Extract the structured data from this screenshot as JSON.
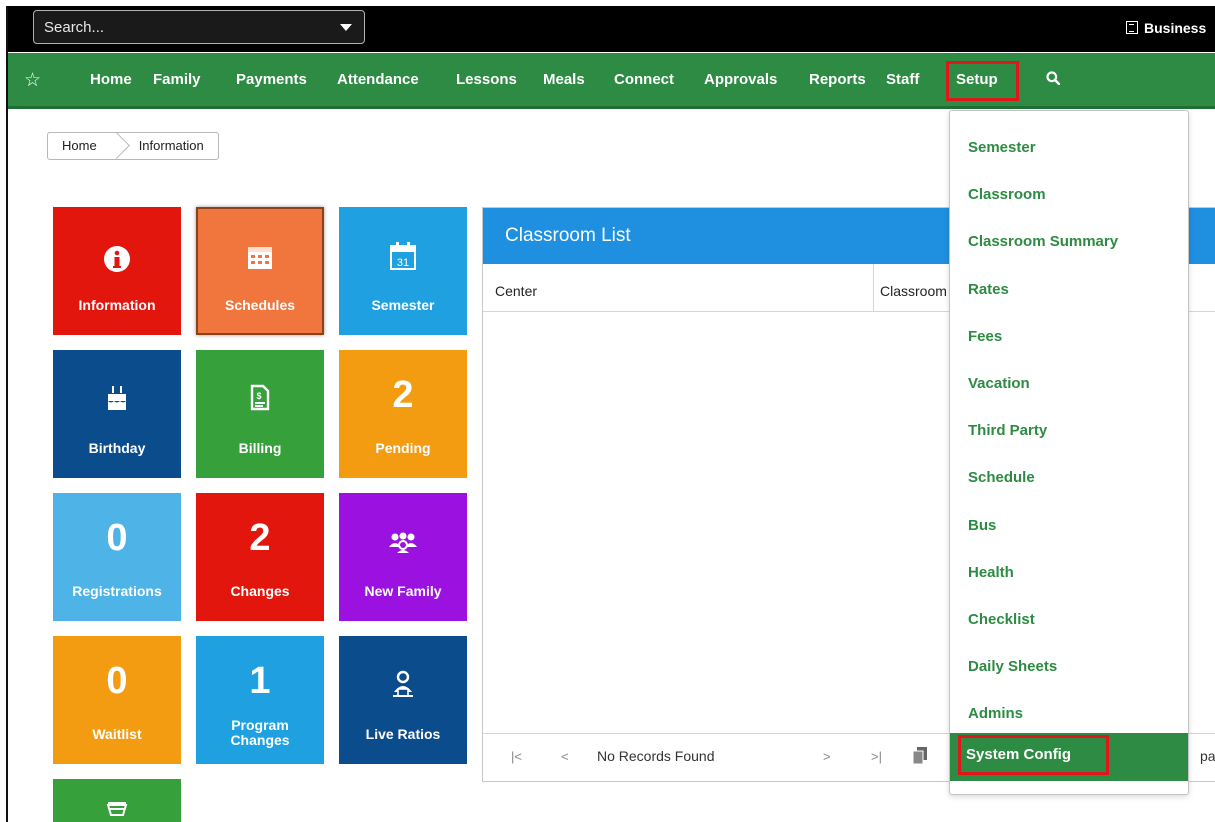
{
  "topbar": {
    "search_placeholder": "Search...",
    "business_label": "Business"
  },
  "nav": {
    "items": [
      "Home",
      "Family",
      "Payments",
      "Attendance",
      "Lessons",
      "Meals",
      "Connect",
      "Approvals",
      "Reports",
      "Staff",
      "Setup"
    ]
  },
  "breadcrumb": [
    "Home",
    "Information"
  ],
  "tiles": [
    {
      "label": "Information",
      "color": "#e2160d",
      "icon": "info-icon"
    },
    {
      "label": "Schedules",
      "color": "#f0763e",
      "icon": "calendar-grid-icon"
    },
    {
      "label": "Semester",
      "color": "#1fa0e1",
      "icon": "calendar-31-icon"
    },
    {
      "label": "Birthday",
      "color": "#0b4c8c",
      "icon": "birthday-cake-icon"
    },
    {
      "label": "Billing",
      "color": "#36a03b",
      "icon": "invoice-icon"
    },
    {
      "label": "Pending",
      "color": "#f39c12",
      "number": "2"
    },
    {
      "label": "Registrations",
      "color": "#4eb3e6",
      "number": "0"
    },
    {
      "label": "Changes",
      "color": "#e2160d",
      "number": "2"
    },
    {
      "label": "New Family",
      "color": "#9b12e0",
      "icon": "family-group-icon"
    },
    {
      "label": "Waitlist",
      "color": "#f39c12",
      "number": "0"
    },
    {
      "label": "Program Changes",
      "color": "#1fa0e1",
      "number": "1"
    },
    {
      "label": "Live Ratios",
      "color": "#0b4c8c",
      "icon": "teacher-ratio-icon"
    },
    {
      "label": "",
      "color": "#36a03b",
      "icon": "bowl-icon"
    }
  ],
  "classroom_panel": {
    "title": "Classroom List",
    "columns": [
      "Center",
      "Classroom"
    ],
    "pager": {
      "first": "|<",
      "prev": "<",
      "next": ">",
      "last": ">|",
      "status": "No Records Found",
      "page_text": "page"
    }
  },
  "setup_menu": {
    "items": [
      "Semester",
      "Classroom",
      "Classroom Summary",
      "Rates",
      "Fees",
      "Vacation",
      "Third Party",
      "Schedule",
      "Bus",
      "Health",
      "Checklist",
      "Daily Sheets",
      "Admins"
    ],
    "active": "System Config"
  }
}
